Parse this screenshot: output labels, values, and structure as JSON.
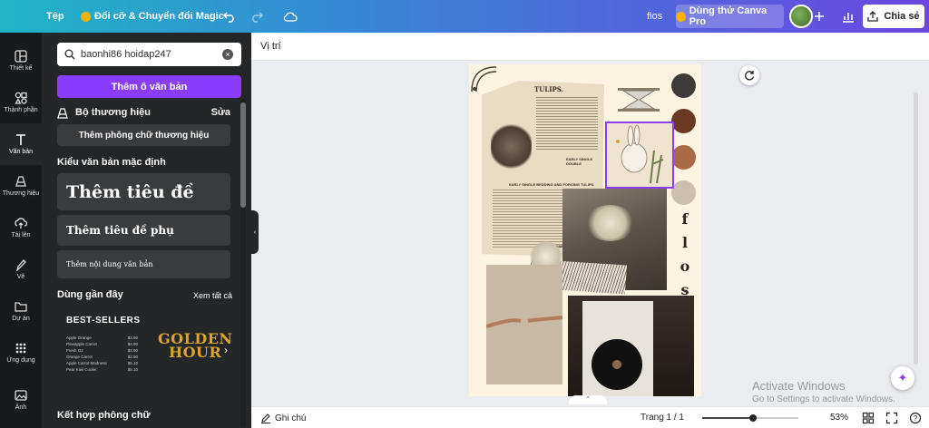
{
  "header": {
    "file_menu": "Tệp",
    "magic_resize": "Đổi cỡ & Chuyển đổi Magic",
    "doc_title": "flos",
    "try_pro": "Dùng thử Canva Pro",
    "share": "Chia sẻ"
  },
  "rail": {
    "items": [
      {
        "label": "Thiết kế",
        "icon": "layout-icon"
      },
      {
        "label": "Thành phần",
        "icon": "shapes-icon"
      },
      {
        "label": "Văn bản",
        "icon": "text-icon"
      },
      {
        "label": "Thương hiệu",
        "icon": "brand-icon"
      },
      {
        "label": "Tải lên",
        "icon": "upload-icon"
      },
      {
        "label": "Vẽ",
        "icon": "draw-icon"
      },
      {
        "label": "Dự án",
        "icon": "folder-icon"
      },
      {
        "label": "Ứng dụng",
        "icon": "apps-icon"
      },
      {
        "label": "Ảnh",
        "icon": "photo-icon"
      }
    ],
    "active_index": 2
  },
  "panel": {
    "search_value": "baonhi86 hoidap247",
    "add_textbox": "Thêm ô văn bản",
    "brand_kit": "Bộ thương hiệu",
    "edit": "Sửa",
    "add_brand_fonts": "Thêm phông chữ thương hiệu",
    "default_styles": "Kiểu văn bản mặc định",
    "add_heading": "Thêm tiêu đề",
    "add_subheading": "Thêm tiêu đề phụ",
    "add_body": "Thêm nội dung văn bản",
    "recently_used": "Dùng gần đây",
    "see_all": "Xem tất cả",
    "font_combos": "Kết hợp phông chữ",
    "bestsellers": {
      "title": "BEST-SELLERS",
      "rows": [
        {
          "name": "Apple Orange",
          "price": "$3.90"
        },
        {
          "name": "Pineapple Carrot",
          "price": "$4.90"
        },
        {
          "name": "Fresh OJ",
          "price": "$3.90"
        },
        {
          "name": "Orange Carrot",
          "price": "$2.90"
        },
        {
          "name": "Apple Carrot Madness",
          "price": "$5.10"
        },
        {
          "name": "Pear Kiwi Cooler",
          "price": "$5.10"
        }
      ]
    },
    "golden_hour": {
      "line1": "GOLDEN",
      "line2": "HOUR"
    }
  },
  "toolbar": {
    "position": "Vị trí"
  },
  "canvas": {
    "vertical_word": [
      "f",
      "l",
      "o",
      "s"
    ],
    "swatches": [
      "#3d3b3a",
      "#6b3a22",
      "#a96a45",
      "#cbbfae"
    ],
    "background": "#fdf3e1",
    "newspaper_heading": "TULIPS.",
    "newspaper_sub": "EARLY SINGLE DOUBLE",
    "newspaper_sub2": "EARLY SINGLE BEDDING AND FORCING TULIPS.",
    "parrot": "PARROT TULIPS"
  },
  "bottom": {
    "notes": "Ghi chú",
    "page": "Trang 1 / 1",
    "zoom": "53%",
    "zoom_fraction": 0.53
  },
  "watermark": {
    "line1": "Activate Windows",
    "line2": "Go to Settings to activate Windows."
  },
  "colors": {
    "accent": "#8b3dff",
    "panel_bg": "#252627",
    "rail_bg": "#18191b"
  }
}
